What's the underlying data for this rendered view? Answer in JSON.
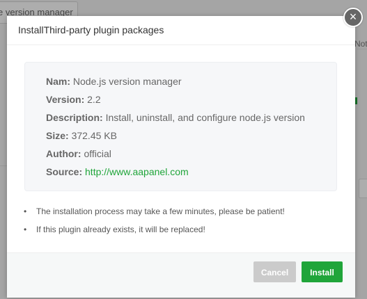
{
  "background": {
    "tab_label": "e version manager",
    "right_text": "Not"
  },
  "modal": {
    "title": "InstallThird-party plugin packages",
    "close_glyph": "×",
    "info": [
      {
        "key": "Nam:",
        "value": "Node.js version manager"
      },
      {
        "key": "Version:",
        "value": "2.2"
      },
      {
        "key": "Description:",
        "value": "Install, uninstall, and configure node.js version"
      },
      {
        "key": "Size:",
        "value": "372.45 KB"
      },
      {
        "key": "Author:",
        "value": "official"
      },
      {
        "key": "Source:",
        "value": "http://www.aapanel.com"
      }
    ],
    "notes": [
      "The installation process may take a few minutes, please be patient!",
      "If this plugin already exists, it will be replaced!"
    ],
    "bullet": "•",
    "buttons": {
      "cancel": "Cancel",
      "install": "Install"
    }
  },
  "colors": {
    "accent_green": "#20a53a",
    "cancel_gray": "#cbcbcb",
    "close_button": "#666666"
  }
}
